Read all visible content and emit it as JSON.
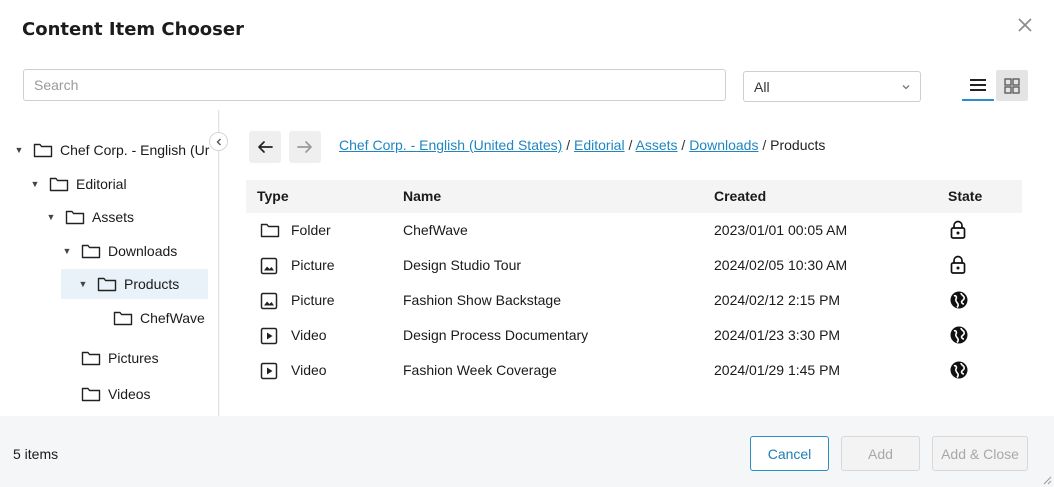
{
  "dialog": {
    "title": "Content Item Chooser"
  },
  "search": {
    "placeholder": "Search",
    "value": ""
  },
  "filter": {
    "selected": "All"
  },
  "tree": {
    "nodes": [
      {
        "label": "Chef Corp. - English (Ur",
        "expanded": true
      },
      {
        "label": "Editorial",
        "expanded": true
      },
      {
        "label": "Assets",
        "expanded": true
      },
      {
        "label": "Downloads",
        "expanded": true
      },
      {
        "label": "Products",
        "expanded": true,
        "selected": true
      },
      {
        "label": "ChefWave"
      },
      {
        "label": "Pictures"
      },
      {
        "label": "Videos"
      }
    ]
  },
  "breadcrumb": {
    "links": [
      "Chef Corp. - English (United States)",
      "Editorial",
      "Assets",
      "Downloads"
    ],
    "separator": " / ",
    "current": "Products"
  },
  "table": {
    "columns": [
      "Type",
      "Name",
      "Created",
      "State"
    ],
    "rows": [
      {
        "type": "Folder",
        "type_icon": "folder-icon",
        "name": "ChefWave",
        "created": "2023/01/01 00:05 AM",
        "state_icon": "lock-icon"
      },
      {
        "type": "Picture",
        "type_icon": "picture-icon",
        "name": "Design Studio Tour",
        "created": "2024/02/05 10:30 AM",
        "state_icon": "lock-icon"
      },
      {
        "type": "Picture",
        "type_icon": "picture-icon",
        "name": "Fashion Show Backstage",
        "created": "2024/02/12 2:15 PM",
        "state_icon": "globe-icon"
      },
      {
        "type": "Video",
        "type_icon": "video-icon",
        "name": "Design Process Documentary",
        "created": "2024/01/23 3:30 PM",
        "state_icon": "globe-icon"
      },
      {
        "type": "Video",
        "type_icon": "video-icon",
        "name": "Fashion Week Coverage",
        "created": "2024/01/29 1:45 PM",
        "state_icon": "globe-icon"
      }
    ]
  },
  "footer": {
    "count": "5 items",
    "cancel_label": "Cancel",
    "add_label": "Add",
    "add_close_label": "Add & Close"
  },
  "colors": {
    "accent": "#2a8fc6",
    "link": "#1f86c1",
    "disabled_text": "#a8a8a8"
  }
}
